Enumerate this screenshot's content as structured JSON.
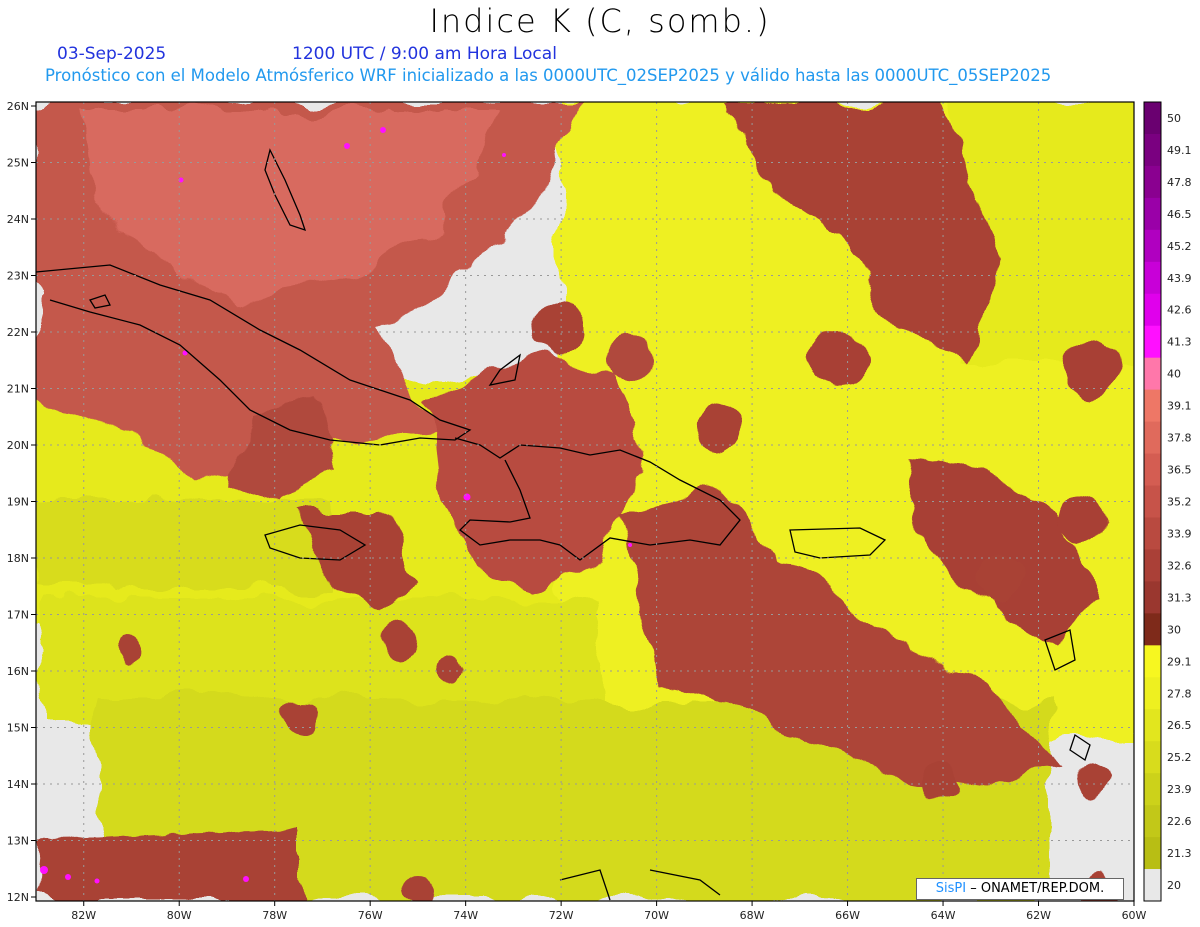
{
  "header": {
    "title": "Indice K (C, somb.)",
    "date": "03-Sep-2025",
    "time": "1200 UTC / 9:00 am Hora Local",
    "description": "Pronóstico con el Modelo Atmósferico WRF inicializado a las 0000UTC_02SEP2025 y válido hasta las  0000UTC_05SEP2025"
  },
  "map": {
    "lat_labels": [
      "26N",
      "25N",
      "24N",
      "23N",
      "22N",
      "21N",
      "20N",
      "19N",
      "18N",
      "17N",
      "16N",
      "15N",
      "14N",
      "13N",
      "12N"
    ],
    "lon_labels": [
      "82W",
      "80W",
      "78W",
      "76W",
      "74W",
      "72W",
      "70W",
      "68W",
      "66W",
      "64W",
      "62W",
      "60W"
    ],
    "credit_system": "SisPI",
    "credit_rest": " – ONAMET/REP.DOM."
  },
  "colorbar": {
    "labels": [
      "50",
      "49.1",
      "47.8",
      "46.5",
      "45.2",
      "43.9",
      "42.6",
      "41.3",
      "40",
      "39.1",
      "37.8",
      "36.5",
      "35.2",
      "33.9",
      "32.6",
      "31.3",
      "30",
      "29.1",
      "27.8",
      "26.5",
      "25.2",
      "23.9",
      "22.6",
      "21.3",
      "20"
    ],
    "colors": [
      "#6a0070",
      "#7a0080",
      "#8a0090",
      "#9a00a8",
      "#b000c0",
      "#c800d8",
      "#e000ec",
      "#ff10ff",
      "#ff77aa",
      "#ee7766",
      "#e06a5c",
      "#d45d52",
      "#c75349",
      "#b94a40",
      "#aa4037",
      "#9a372f",
      "#7e2a1a",
      "#f7f720",
      "#eef020",
      "#e2e61e",
      "#d8dc1c",
      "#ccd21a",
      "#c2c818",
      "#b8be14",
      "#e8e8e8"
    ]
  }
}
